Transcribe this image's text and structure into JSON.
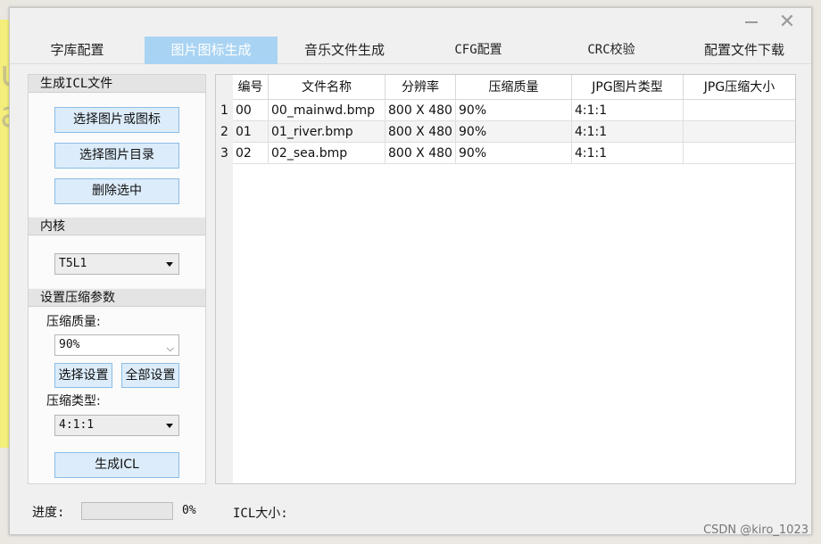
{
  "window": {
    "controls": {
      "minimize_icon": "minimize-icon",
      "close_icon": "close-icon",
      "close_glyph": "✕"
    }
  },
  "tabs": [
    {
      "label": "字库配置",
      "active": false
    },
    {
      "label": "图片图标生成",
      "active": true
    },
    {
      "label": "音乐文件生成",
      "active": false
    },
    {
      "label": "CFG配置",
      "active": false
    },
    {
      "label": "CRC校验",
      "active": false
    },
    {
      "label": "配置文件下载",
      "active": false
    }
  ],
  "left": {
    "icl_group": {
      "title": "生成ICL文件",
      "select_image_button": "选择图片或图标",
      "select_dir_button": "选择图片目录",
      "delete_button": "删除选中"
    },
    "core_group": {
      "title": "内核",
      "core_select_value": "T5L1"
    },
    "compress_group": {
      "title": "设置压缩参数",
      "quality_label": "压缩质量:",
      "quality_value": "90%",
      "select_set_button": "选择设置",
      "all_set_button": "全部设置",
      "type_label": "压缩类型:",
      "type_value": "4:1:1",
      "generate_button": "生成ICL"
    }
  },
  "table": {
    "columns": [
      "编号",
      "文件名称",
      "分辨率",
      "压缩质量",
      "JPG图片类型",
      "JPG压缩大小"
    ],
    "rows": [
      {
        "row_num": "1",
        "cells": [
          "00",
          "00_mainwd.bmp",
          "800 X 480",
          "90%",
          "4:1:1",
          ""
        ]
      },
      {
        "row_num": "2",
        "cells": [
          "01",
          "01_river.bmp",
          "800 X 480",
          "90%",
          "4:1:1",
          ""
        ]
      },
      {
        "row_num": "3",
        "cells": [
          "02",
          "02_sea.bmp",
          "800 X 480",
          "90%",
          "4:1:1",
          ""
        ]
      }
    ]
  },
  "footer": {
    "progress_label": "进度:",
    "progress_value": "0%",
    "progress_fraction": 0,
    "icl_size_label": "ICL大小:"
  },
  "watermark": "CSDN @kiro_1023",
  "colors": {
    "active_tab": "#a9d3f2",
    "button_bg": "#dcecfa",
    "button_border": "#8cbde6"
  }
}
